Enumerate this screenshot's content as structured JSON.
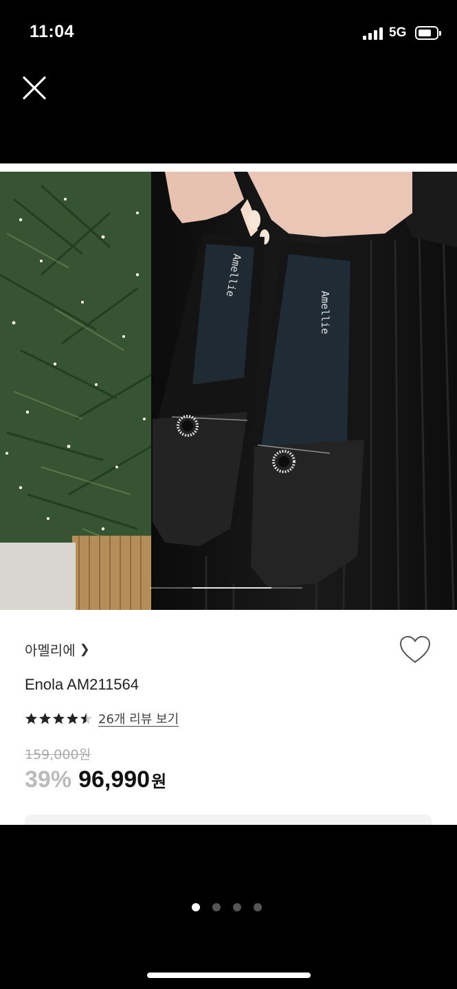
{
  "status_bar": {
    "time": "11:04",
    "network": "5G"
  },
  "close_icon": "close-icon",
  "product": {
    "image_text_left": "Amellie",
    "image_text_right": "Amellie",
    "image_progress": 0.72,
    "brand": "아멜리에",
    "name": "Enola AM211564",
    "rating": 4.5,
    "review_link": "26개 리뷰 보기",
    "original_price": "159,000원",
    "discount": "39%",
    "price": "96,990",
    "currency": "원"
  },
  "pager": {
    "count": 4,
    "active_index": 0
  },
  "colors": {
    "background": "#000000",
    "card": "#ffffff",
    "discount": "#bbbbbb"
  }
}
